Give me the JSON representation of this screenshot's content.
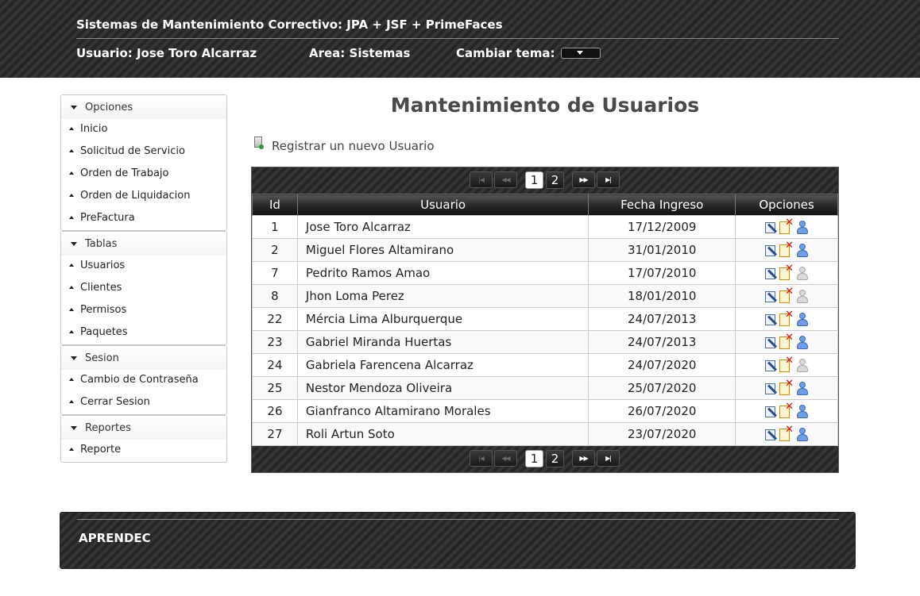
{
  "header": {
    "title": "Sistemas de Mantenimiento Correctivo: JPA + JSF + PrimeFaces",
    "usuario": "Usuario: Jose Toro Alcarraz",
    "area": "Area: Sistemas",
    "theme_label": "Cambiar tema:"
  },
  "menu": {
    "groups": [
      {
        "label": "Opciones",
        "items": [
          "Inicio",
          "Solicitud de Servicio",
          "Orden de Trabajo",
          "Orden de Liquidacion",
          "PreFactura"
        ]
      },
      {
        "label": "Tablas",
        "items": [
          "Usuarios",
          "Clientes",
          "Permisos",
          "Paquetes"
        ]
      },
      {
        "label": "Sesion",
        "items": [
          "Cambio de Contraseña",
          "Cerrar Sesion"
        ]
      },
      {
        "label": "Reportes",
        "items": [
          "Reporte"
        ]
      }
    ]
  },
  "main": {
    "title": "Mantenimiento de Usuarios",
    "register_label": "Registrar un nuevo Usuario",
    "paginator": {
      "first": "|◀",
      "prev": "◀◀",
      "pages": [
        "1",
        "2"
      ],
      "current_page": "1",
      "next": "▶▶",
      "last": "▶|"
    },
    "table": {
      "columns": [
        "Id",
        "Usuario",
        "Fecha Ingreso",
        "Opciones"
      ],
      "rows": [
        {
          "id": "1",
          "usuario": "Jose Toro Alcarraz",
          "fecha": "17/12/2009",
          "user_icon": "user-active-icon"
        },
        {
          "id": "2",
          "usuario": "Miguel Flores Altamirano",
          "fecha": "31/01/2010",
          "user_icon": "user-active-icon"
        },
        {
          "id": "7",
          "usuario": "Pedrito Ramos Amao",
          "fecha": "17/07/2010",
          "user_icon": "user-inactive-icon"
        },
        {
          "id": "8",
          "usuario": "Jhon Loma Perez",
          "fecha": "18/01/2010",
          "user_icon": "user-inactive-icon"
        },
        {
          "id": "22",
          "usuario": "Mércia Lima Alburquerque",
          "fecha": "24/07/2013",
          "user_icon": "user-active-icon"
        },
        {
          "id": "23",
          "usuario": "Gabriel Miranda Huertas",
          "fecha": "24/07/2013",
          "user_icon": "user-active-icon"
        },
        {
          "id": "24",
          "usuario": "Gabriela Farencena Alcarraz",
          "fecha": "24/07/2020",
          "user_icon": "user-inactive-icon"
        },
        {
          "id": "25",
          "usuario": "Nestor Mendoza Oliveira",
          "fecha": "25/07/2020",
          "user_icon": "user-active-icon"
        },
        {
          "id": "26",
          "usuario": "Gianfranco Altamirano Morales",
          "fecha": "26/07/2020",
          "user_icon": "user-active-icon"
        },
        {
          "id": "27",
          "usuario": "Roli Artun Soto",
          "fecha": "23/07/2020",
          "user_icon": "user-active-icon"
        }
      ]
    }
  },
  "footer": {
    "label": "APRENDEC"
  },
  "colors": {
    "header_bg": "#2c2c2c",
    "title_text": "#4a4a4a",
    "edit_icon": "#2b4f8a",
    "delete_icon": "#e01010",
    "user_active": "#6f9ee6",
    "user_inactive": "#d9d9d9"
  }
}
